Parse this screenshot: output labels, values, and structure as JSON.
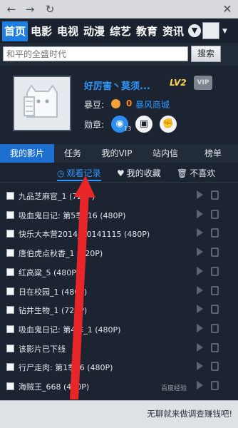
{
  "title_bar": {
    "back_icon": "arrow-left-icon",
    "forward_icon": "arrow-right-icon",
    "refresh_icon": "refresh-icon",
    "close_icon": "close-icon"
  },
  "categories": [
    {
      "label": "首页",
      "active": true
    },
    {
      "label": "电影",
      "active": false
    },
    {
      "label": "电视",
      "active": false
    },
    {
      "label": "动漫",
      "active": false
    },
    {
      "label": "综艺",
      "active": false
    },
    {
      "label": "教育",
      "active": false
    },
    {
      "label": "资讯",
      "active": false
    }
  ],
  "search": {
    "placeholder": "和平的全盛时代",
    "button": "搜索"
  },
  "profile": {
    "username": "好厉害丶莫须...",
    "level": "LV2",
    "vip": "VIP",
    "coin_label": "暴豆:",
    "coin_count": "0",
    "shop_link": "暴风商城",
    "medal_label": "勋章:",
    "medal_count": "13"
  },
  "tabs": [
    {
      "label": "我的影片",
      "active": true
    },
    {
      "label": "任务",
      "active": false
    },
    {
      "label": "我的VIP",
      "active": false
    },
    {
      "label": "站内信",
      "active": false
    },
    {
      "label": "榜单",
      "active": false
    }
  ],
  "subtabs": [
    {
      "label": "观看记录",
      "icon": "clock-icon",
      "active": true
    },
    {
      "label": "我的收藏",
      "icon": "heart-icon",
      "active": false
    },
    {
      "label": "不喜欢",
      "icon": "trash-icon",
      "active": false
    }
  ],
  "history": [
    "九品芝麻官_1 (720P)",
    "吸血鬼日记: 第5季_16 (480P)",
    "快乐大本营2014_20141115 (480P)",
    "唐伯虎点秋香_1 (720P)",
    "红高粱_5 (480P)",
    "日在校园_1 (480P)",
    "钻井生物_1 (720P)",
    "吸血鬼日记: 第4季_1 (480P)",
    "该影片已下线",
    "行尸走肉: 第1季_6 (480P)",
    "海贼王_668 (480P)"
  ],
  "footer": {
    "text": "无聊就来做调查赚钱吧!"
  },
  "watermark": "百度经验"
}
